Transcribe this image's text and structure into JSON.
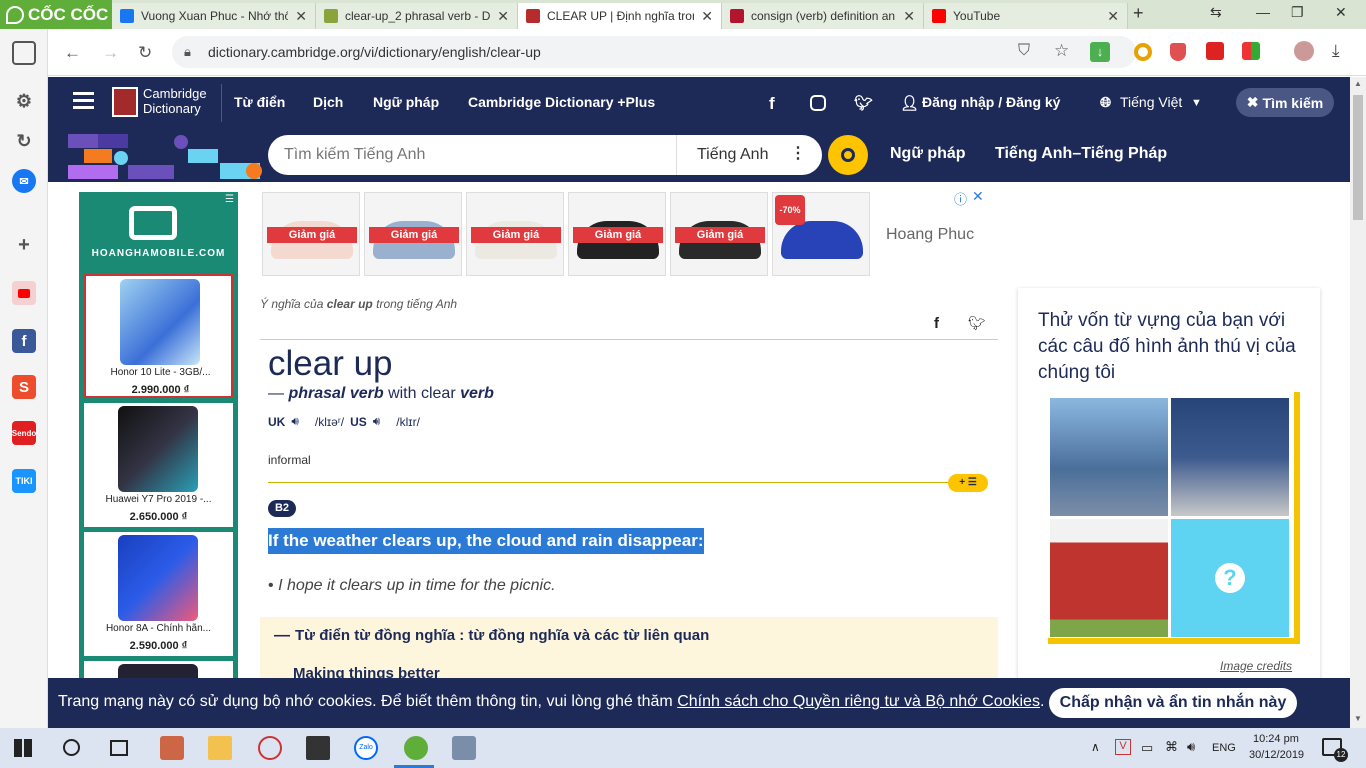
{
  "browser": {
    "brand": "CỐC CỐC",
    "tabs": [
      {
        "title": "Vuong Xuan Phuc - Nhớ thô",
        "color": "#1877f2"
      },
      {
        "title": "clear-up_2 phrasal verb - De",
        "color": "#8aa33a"
      },
      {
        "title": "CLEAR UP | Định nghĩa tron",
        "color": "#b62c2c"
      },
      {
        "title": "consign (verb) definition an",
        "color": "#b1162d"
      },
      {
        "title": "YouTube",
        "color": "#ff0000"
      }
    ],
    "tab_close": "✕",
    "new_tab": "+",
    "url": "dictionary.cambridge.org/vi/dictionary/english/clear-up"
  },
  "header": {
    "logo_line1": "Cambridge",
    "logo_line2": "Dictionary",
    "nav": [
      "Từ điển",
      "Dịch",
      "Ngữ pháp",
      "Cambridge Dictionary +Plus"
    ],
    "login": "Đăng nhập / Đăng ký",
    "language": "Tiếng Việt",
    "search_button": "Tìm kiếm"
  },
  "subheader": {
    "search_placeholder": "Tìm kiếm Tiếng Anh",
    "search_lang": "Tiếng Anh",
    "links": [
      "Ngữ pháp",
      "Tiếng Anh–Tiếng Pháp"
    ]
  },
  "side_ad": {
    "logo": "HOANGHAMOBILE.COM",
    "products": [
      {
        "name": "Honor 10 Lite - 3GB/...",
        "price": "2.990.000 ₫"
      },
      {
        "name": "Huawei Y7 Pro 2019 -...",
        "price": "2.650.000 ₫"
      },
      {
        "name": "Honor 8A - Chính hãn...",
        "price": "2.590.000 ₫"
      }
    ]
  },
  "top_ad": {
    "sale_label": "Giảm giá",
    "discount": "-70%",
    "advertiser": "Hoang Phuc"
  },
  "entry": {
    "breadcrumb_pre": "Ý nghĩa của",
    "breadcrumb_word": "clear up",
    "breadcrumb_post": "trong tiếng Anh",
    "headword": "clear up",
    "pos_dash": "—",
    "pos": "phrasal verb",
    "pos_with": "with clear",
    "pos_base": "verb",
    "uk_label": "UK",
    "uk_ipa": "/klɪəʳ/",
    "us_label": "US",
    "us_ipa": "/klɪr/",
    "register": "informal",
    "level": "B2",
    "definition": "If the weather clears up, the cloud and rain disappear:",
    "example": "I hope it clears up in time for the picnic.",
    "thesaurus_title": "Từ điển từ đồng nghĩa : từ đồng nghĩa và các từ liên quan",
    "thesaurus_sub": "Making things better",
    "add_list": "+ ☰"
  },
  "quiz": {
    "title": "Thử vốn từ vựng của bạn với các câu đố hình ảnh thú vị của chúng tôi",
    "credits": "Image credits",
    "question_mark": "?"
  },
  "cookie": {
    "text": "Trang mạng này có sử dụng bộ nhớ cookies. Để biết thêm thông tin, vui lòng ghé thăm",
    "link": "Chính sách cho Quyền riêng tư và Bộ nhớ Cookies",
    "period": ".",
    "button": "Chấp nhận và ẩn tin nhắn này"
  },
  "taskbar": {
    "language": "ENG",
    "time": "10:24 pm",
    "date": "30/12/2019",
    "notifications": "12"
  },
  "sidebar_apps": {
    "shopee": "S",
    "sendo": "Sendo",
    "tiki": "TIKI"
  }
}
